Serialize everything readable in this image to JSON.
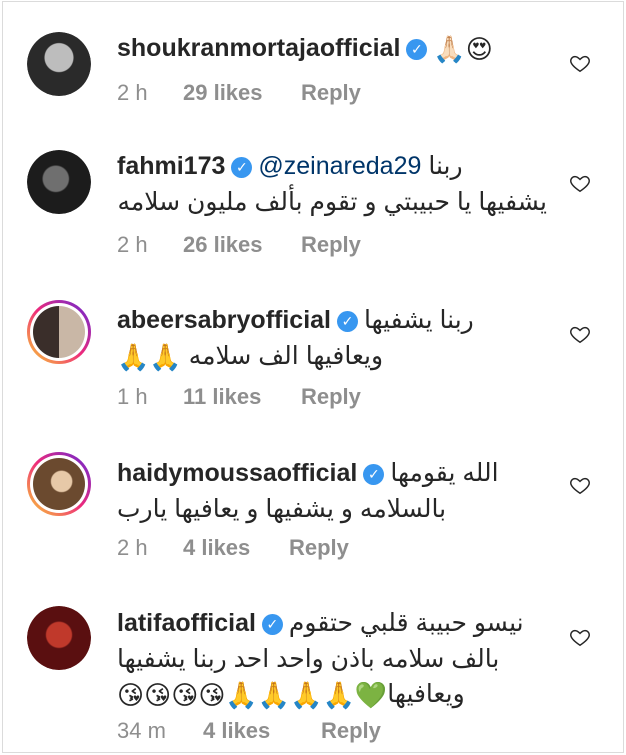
{
  "comments": [
    {
      "username": "shoukranmortajaofficial",
      "text_rtl": "",
      "emoji": [
        "🙏🏻",
        "😍"
      ],
      "lines": [],
      "time": "2 h",
      "likes": "29 likes",
      "reply": "Reply",
      "avatar_ring": false,
      "avatar_colors": [
        "#2a2a2a",
        "#bdbdbd"
      ]
    },
    {
      "username": "fahmi173",
      "mention": "@zeinareda29",
      "text_rtl": "ربنا",
      "lines": [
        "يشفيها يا حبيبتي و تقوم بألف مليون سلامه"
      ],
      "time": "2 h",
      "likes": "26 likes",
      "reply": "Reply",
      "avatar_ring": false,
      "avatar_colors": [
        "#1c1c1c",
        "#6f6f6f"
      ]
    },
    {
      "username": "abeersabryofficial",
      "text_rtl": "ربنا يشفيها",
      "lines": [
        "ويعافيها الف سلامه"
      ],
      "line_emoji": "🙏🙏",
      "time": "1 h",
      "likes": "11 likes",
      "reply": "Reply",
      "avatar_ring": true,
      "avatar_colors": [
        "#3a2e2a",
        "#c9b7a6"
      ]
    },
    {
      "username": "haidymoussaofficial",
      "text_rtl": "الله يقومها",
      "lines": [
        "بالسلامه و يشفيها و يعافيها يارب"
      ],
      "time": "2 h",
      "likes": "4 likes",
      "reply": "Reply",
      "avatar_ring": true,
      "avatar_colors": [
        "#6b4a2f",
        "#e7c9a8"
      ]
    },
    {
      "username": "latifaofficial",
      "text_rtl": "نيسو حبيبة قلبي حتقوم",
      "lines": [
        "بالف سلامه باذن واحد احد ربنا يشفيها",
        "ويعافيها"
      ],
      "line3_emoji": "💚🙏🙏🙏🙏😘😘😘😘",
      "time": "34 m",
      "likes": "4 likes",
      "reply": "Reply",
      "avatar_ring": false,
      "avatar_colors": [
        "#5a0f10",
        "#c0392b"
      ]
    }
  ],
  "colors": {
    "verified": "#3897f0",
    "meta": "#8e8e8e",
    "text": "#262626",
    "mention": "#003569"
  }
}
